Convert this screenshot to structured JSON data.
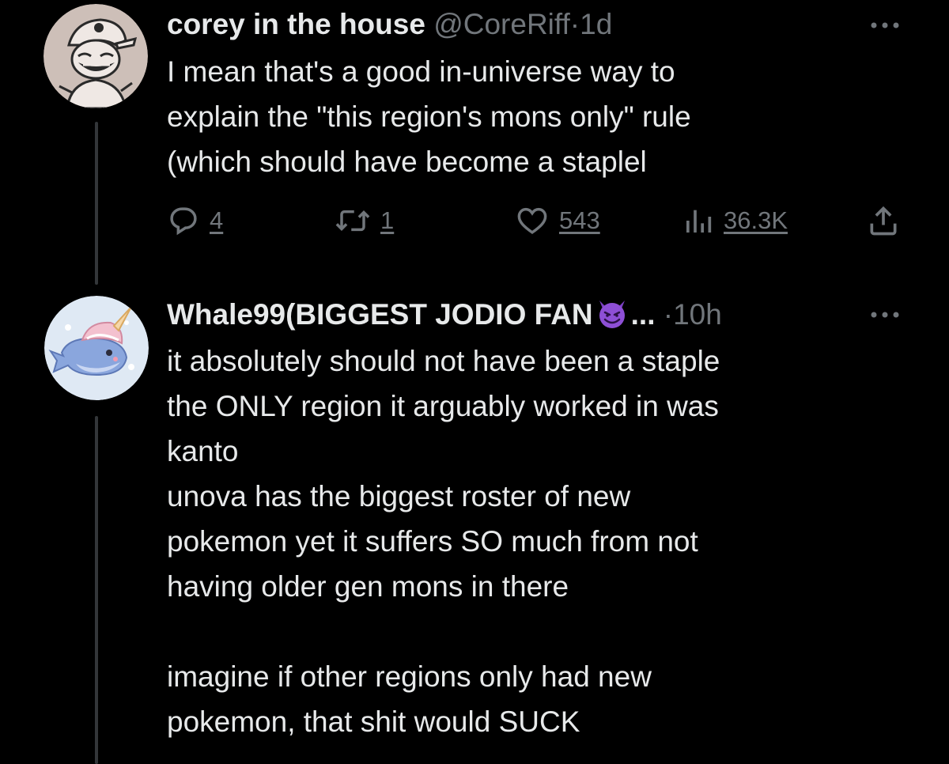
{
  "colors": {
    "background": "#000000",
    "text_primary": "#e7e9ea",
    "text_secondary": "#71767b",
    "thread_line": "#333639"
  },
  "tweets": [
    {
      "display_name": "corey in the house",
      "handle": "@CoreRiff",
      "separator": "·",
      "time": "1d",
      "avatar_icon": "cartoon-face-avatar",
      "lines": [
        "I mean that's a good in-universe way to",
        "explain the \"this region's mons only\" rule",
        "(which should have become a staplel"
      ],
      "actions": {
        "reply_count": "4",
        "retweet_count": "1",
        "like_count": "543",
        "view_count": "36.3K"
      }
    },
    {
      "display_name": "Whale99(BIGGEST JODIO FAN",
      "name_emoji": "smiling-devil-emoji",
      "truncation": "...",
      "separator": "·",
      "time": "10h",
      "avatar_icon": "narwhal-avatar",
      "lines": [
        "it absolutely should not have been a staple",
        "the ONLY region it arguably worked in was",
        "kanto",
        "unova has the biggest roster of new",
        "pokemon yet it suffers SO much from not",
        "having older gen mons in there",
        "",
        "imagine if other regions only had new",
        "pokemon, that shit would SUCK"
      ]
    }
  ]
}
